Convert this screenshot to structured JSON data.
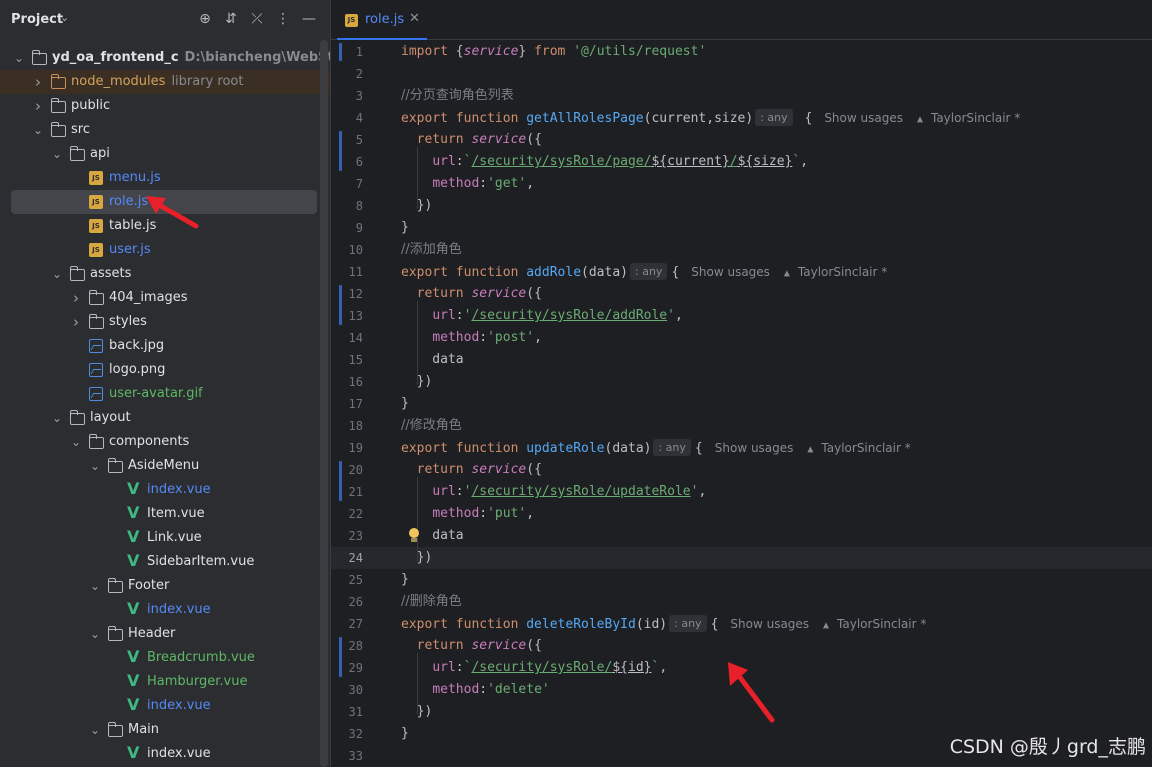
{
  "project": {
    "title": "Project",
    "tree": [
      {
        "label": "yd_oa_frontend_c",
        "hint": "D:\\biancheng\\WebStormProj",
        "kind": "folder",
        "depth": 0,
        "arrow": "open",
        "style": "bold"
      },
      {
        "label": "node_modules",
        "hint": "library root",
        "kind": "folder-orange",
        "depth": 1,
        "arrow": "closed",
        "style": "orange"
      },
      {
        "label": "public",
        "hint": "",
        "kind": "folder",
        "depth": 1,
        "arrow": "closed",
        "style": ""
      },
      {
        "label": "src",
        "hint": "",
        "kind": "folder",
        "depth": 1,
        "arrow": "open",
        "style": ""
      },
      {
        "label": "api",
        "hint": "",
        "kind": "folder",
        "depth": 2,
        "arrow": "open",
        "style": ""
      },
      {
        "label": "menu.js",
        "hint": "",
        "kind": "js",
        "depth": 3,
        "arrow": "",
        "style": "blue"
      },
      {
        "label": "role.js",
        "hint": "",
        "kind": "js",
        "depth": 3,
        "arrow": "",
        "style": "blue",
        "selected": true
      },
      {
        "label": "table.js",
        "hint": "",
        "kind": "js",
        "depth": 3,
        "arrow": "",
        "style": ""
      },
      {
        "label": "user.js",
        "hint": "",
        "kind": "js",
        "depth": 3,
        "arrow": "",
        "style": "blue"
      },
      {
        "label": "assets",
        "hint": "",
        "kind": "folder",
        "depth": 2,
        "arrow": "open",
        "style": ""
      },
      {
        "label": "404_images",
        "hint": "",
        "kind": "folder",
        "depth": 3,
        "arrow": "closed",
        "style": ""
      },
      {
        "label": "styles",
        "hint": "",
        "kind": "folder",
        "depth": 3,
        "arrow": "closed",
        "style": ""
      },
      {
        "label": "back.jpg",
        "hint": "",
        "kind": "image",
        "depth": 3,
        "arrow": "",
        "style": ""
      },
      {
        "label": "logo.png",
        "hint": "",
        "kind": "image",
        "depth": 3,
        "arrow": "",
        "style": ""
      },
      {
        "label": "user-avatar.gif",
        "hint": "",
        "kind": "image",
        "depth": 3,
        "arrow": "",
        "style": "green"
      },
      {
        "label": "layout",
        "hint": "",
        "kind": "folder",
        "depth": 2,
        "arrow": "open",
        "style": ""
      },
      {
        "label": "components",
        "hint": "",
        "kind": "folder",
        "depth": 3,
        "arrow": "open",
        "style": ""
      },
      {
        "label": "AsideMenu",
        "hint": "",
        "kind": "folder",
        "depth": 4,
        "arrow": "open",
        "style": ""
      },
      {
        "label": "index.vue",
        "hint": "",
        "kind": "vue",
        "depth": 5,
        "arrow": "",
        "style": "blue"
      },
      {
        "label": "Item.vue",
        "hint": "",
        "kind": "vue",
        "depth": 5,
        "arrow": "",
        "style": ""
      },
      {
        "label": "Link.vue",
        "hint": "",
        "kind": "vue",
        "depth": 5,
        "arrow": "",
        "style": ""
      },
      {
        "label": "SidebarItem.vue",
        "hint": "",
        "kind": "vue",
        "depth": 5,
        "arrow": "",
        "style": ""
      },
      {
        "label": "Footer",
        "hint": "",
        "kind": "folder",
        "depth": 4,
        "arrow": "open",
        "style": ""
      },
      {
        "label": "index.vue",
        "hint": "",
        "kind": "vue",
        "depth": 5,
        "arrow": "",
        "style": "blue"
      },
      {
        "label": "Header",
        "hint": "",
        "kind": "folder",
        "depth": 4,
        "arrow": "open",
        "style": ""
      },
      {
        "label": "Breadcrumb.vue",
        "hint": "",
        "kind": "vue",
        "depth": 5,
        "arrow": "",
        "style": "green"
      },
      {
        "label": "Hamburger.vue",
        "hint": "",
        "kind": "vue",
        "depth": 5,
        "arrow": "",
        "style": "green"
      },
      {
        "label": "index.vue",
        "hint": "",
        "kind": "vue",
        "depth": 5,
        "arrow": "",
        "style": "blue"
      },
      {
        "label": "Main",
        "hint": "",
        "kind": "folder",
        "depth": 4,
        "arrow": "open",
        "style": ""
      },
      {
        "label": "index.vue",
        "hint": "",
        "kind": "vue",
        "depth": 5,
        "arrow": "",
        "style": ""
      }
    ]
  },
  "editor": {
    "tab_label": "role.js",
    "current_line": 24,
    "lines": [
      [
        [
          "kw",
          "import "
        ],
        [
          "",
          "{"
        ],
        [
          "svc",
          "service"
        ],
        [
          "",
          "} "
        ],
        [
          "kw",
          "from "
        ],
        [
          "str",
          "'@/utils/request'"
        ]
      ],
      [],
      [
        [
          "cmt",
          "//分页查询角色列表"
        ]
      ],
      [
        [
          "kw",
          "export function "
        ],
        [
          "fn",
          "getAllRolesPage"
        ],
        [
          "",
          "(current,size)"
        ],
        [
          "hint",
          "any"
        ],
        [
          "",
          " {"
        ],
        [
          "inlay",
          "Show usages"
        ],
        [
          "person",
          ""
        ],
        [
          "inlay-author",
          "TaylorSinclair *"
        ]
      ],
      [
        [
          "",
          "  "
        ],
        [
          "kw",
          "return "
        ],
        [
          "svc",
          "service"
        ],
        [
          "",
          "({"
        ]
      ],
      [
        [
          "",
          "    "
        ],
        [
          "prop",
          "url"
        ],
        [
          "",
          ":"
        ],
        [
          "str",
          "`"
        ],
        [
          "str-u",
          "/security/sysRole/page/"
        ],
        [
          "tpl",
          "${current}"
        ],
        [
          "str-u",
          "/"
        ],
        [
          "tpl",
          "${size}"
        ],
        [
          "str",
          "`"
        ],
        [
          "",
          ","
        ]
      ],
      [
        [
          "",
          "    "
        ],
        [
          "prop",
          "method"
        ],
        [
          "",
          ":"
        ],
        [
          "str",
          "'get'"
        ],
        [
          "",
          ","
        ]
      ],
      [
        [
          "",
          "  })"
        ]
      ],
      [
        [
          "",
          "}"
        ]
      ],
      [
        [
          "cmt",
          "//添加角色"
        ]
      ],
      [
        [
          "kw",
          "export function "
        ],
        [
          "fn",
          "addRole"
        ],
        [
          "",
          "(data)"
        ],
        [
          "hint",
          "any"
        ],
        [
          "",
          "{"
        ],
        [
          "inlay",
          "Show usages"
        ],
        [
          "person",
          ""
        ],
        [
          "inlay-author",
          "TaylorSinclair *"
        ]
      ],
      [
        [
          "",
          "  "
        ],
        [
          "kw",
          "return "
        ],
        [
          "svc",
          "service"
        ],
        [
          "",
          "({"
        ]
      ],
      [
        [
          "",
          "    "
        ],
        [
          "prop",
          "url"
        ],
        [
          "",
          ":"
        ],
        [
          "str",
          "'"
        ],
        [
          "str-u",
          "/security/sysRole/addRole"
        ],
        [
          "str",
          "'"
        ],
        [
          "",
          ","
        ]
      ],
      [
        [
          "",
          "    "
        ],
        [
          "prop",
          "method"
        ],
        [
          "",
          ":"
        ],
        [
          "str",
          "'post'"
        ],
        [
          "",
          ","
        ]
      ],
      [
        [
          "",
          "    data"
        ]
      ],
      [
        [
          "",
          "  })"
        ]
      ],
      [
        [
          "",
          "}"
        ]
      ],
      [
        [
          "cmt",
          "//修改角色"
        ]
      ],
      [
        [
          "kw",
          "export function "
        ],
        [
          "fn",
          "updateRole"
        ],
        [
          "",
          "(data)"
        ],
        [
          "hint",
          "any"
        ],
        [
          "",
          "{"
        ],
        [
          "inlay",
          "Show usages"
        ],
        [
          "person",
          ""
        ],
        [
          "inlay-author",
          "TaylorSinclair *"
        ]
      ],
      [
        [
          "",
          "  "
        ],
        [
          "kw",
          "return "
        ],
        [
          "svc",
          "service"
        ],
        [
          "",
          "({"
        ]
      ],
      [
        [
          "",
          "    "
        ],
        [
          "prop",
          "url"
        ],
        [
          "",
          ":"
        ],
        [
          "str",
          "'"
        ],
        [
          "str-u",
          "/security/sysRole/updateRole"
        ],
        [
          "str",
          "'"
        ],
        [
          "",
          ","
        ]
      ],
      [
        [
          "",
          "    "
        ],
        [
          "prop",
          "method"
        ],
        [
          "",
          ":"
        ],
        [
          "str",
          "'put'"
        ],
        [
          "",
          ","
        ]
      ],
      [
        [
          "",
          "    data"
        ]
      ],
      [
        [
          "",
          "  })"
        ]
      ],
      [
        [
          "",
          "}"
        ]
      ],
      [
        [
          "cmt",
          "//删除角色"
        ]
      ],
      [
        [
          "kw",
          "export function "
        ],
        [
          "fn",
          "deleteRoleById"
        ],
        [
          "",
          "(id)"
        ],
        [
          "hint",
          "any"
        ],
        [
          "",
          "{"
        ],
        [
          "inlay",
          "Show usages"
        ],
        [
          "person",
          ""
        ],
        [
          "inlay-author",
          "TaylorSinclair *"
        ]
      ],
      [
        [
          "",
          "  "
        ],
        [
          "kw",
          "return "
        ],
        [
          "svc",
          "service"
        ],
        [
          "",
          "({"
        ]
      ],
      [
        [
          "",
          "    "
        ],
        [
          "prop",
          "url"
        ],
        [
          "",
          ":"
        ],
        [
          "str",
          "`"
        ],
        [
          "str-u",
          "/security/sysRole/"
        ],
        [
          "tpl",
          "${id}"
        ],
        [
          "str",
          "`"
        ],
        [
          "",
          ","
        ]
      ],
      [
        [
          "",
          "    "
        ],
        [
          "prop",
          "method"
        ],
        [
          "",
          ":"
        ],
        [
          "str",
          "'delete'"
        ]
      ],
      [
        [
          "",
          "  })"
        ]
      ],
      [
        [
          "",
          "}"
        ]
      ],
      []
    ]
  },
  "watermark": "CSDN @殷丿grd_志鹏",
  "colors": {
    "accent": "#3574f0",
    "arrow_red": "#e8202a"
  }
}
